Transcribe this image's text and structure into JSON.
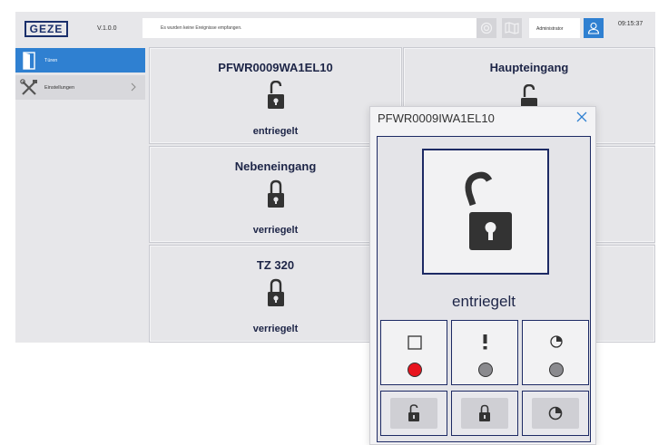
{
  "header": {
    "logo": "GEZE",
    "version": "V.1.0.0",
    "event_message": "Es wurden keine Ereignisse empfangen.",
    "user": "Administrator",
    "time": "09:15:37"
  },
  "sidebar": {
    "items": [
      {
        "label": "Türen",
        "active": true
      },
      {
        "label": "Einstellungen",
        "active": false
      }
    ]
  },
  "doors": [
    {
      "name": "PFWR0009WA1EL10",
      "state": "entriegelt",
      "locked": false
    },
    {
      "name": "Haupteingang",
      "state": "",
      "locked": false
    },
    {
      "name": "Nebeneingang",
      "state": "verriegelt",
      "locked": true
    },
    {
      "name": "TZ 320",
      "state": "verriegelt",
      "locked": true
    }
  ],
  "dialog": {
    "title": "PFWR0009IWA1EL10",
    "state": "entriegelt",
    "indicators": [
      {
        "icon": "square-icon",
        "status_color": "#e8141e"
      },
      {
        "icon": "exclamation-icon",
        "status_color": "#8a8a8e"
      },
      {
        "icon": "timer-icon",
        "status_color": "#8a8a8e"
      }
    ]
  },
  "colors": {
    "accent": "#2f80d1",
    "dark_navy": "#1d2a64",
    "icon_dark": "#333333",
    "active_red": "#e8141e",
    "inactive_grey": "#8a8a8e"
  }
}
